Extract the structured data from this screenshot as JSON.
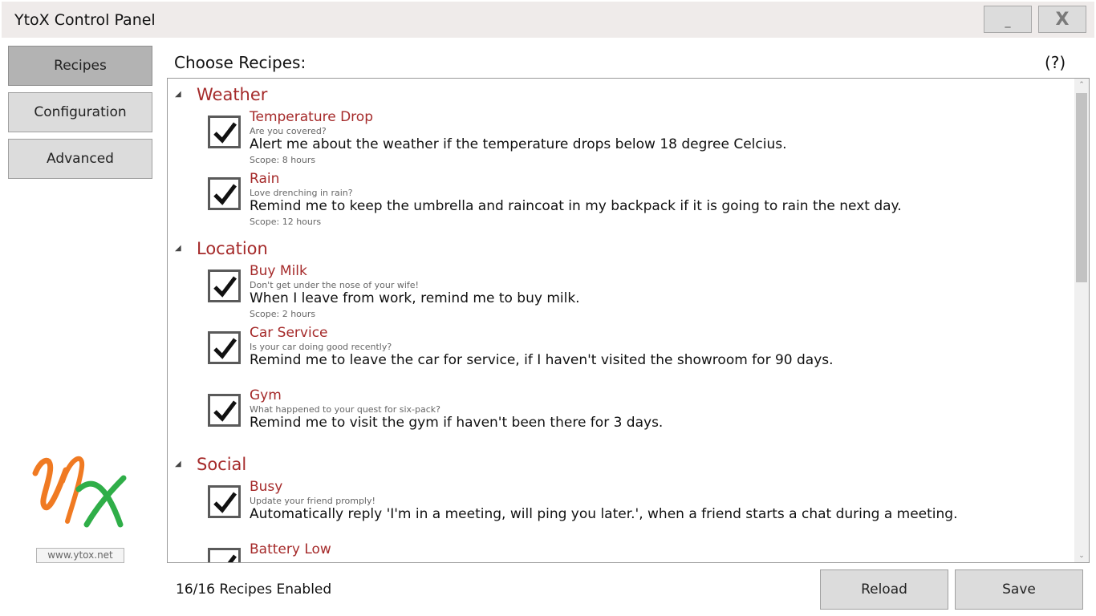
{
  "window": {
    "title": "YtoX Control Panel",
    "minimize_label": "_",
    "close_label": "X"
  },
  "sidebar": {
    "items": [
      {
        "label": "Recipes",
        "active": true
      },
      {
        "label": "Configuration",
        "active": false
      },
      {
        "label": "Advanced",
        "active": false
      }
    ],
    "logo_text": "YX",
    "website": "www.ytox.net"
  },
  "main": {
    "title": "Choose Recipes:",
    "help_label": "(?)"
  },
  "categories": [
    {
      "name": "Weather",
      "recipes": [
        {
          "name": "Temperature Drop",
          "tagline": "Are you covered?",
          "description": "Alert me about the weather if the temperature drops below 18 degree Celcius.",
          "scope": "Scope: 8 hours",
          "checked": true
        },
        {
          "name": "Rain",
          "tagline": "Love drenching in rain?",
          "description": "Remind me to keep the umbrella and raincoat in my backpack if it is going to rain the next day.",
          "scope": "Scope: 12 hours",
          "checked": true
        }
      ]
    },
    {
      "name": "Location",
      "recipes": [
        {
          "name": "Buy Milk",
          "tagline": "Don't get under the nose of your wife!",
          "description": "When I leave from work, remind me to buy milk.",
          "scope": "Scope: 2 hours",
          "checked": true
        },
        {
          "name": "Car Service",
          "tagline": "Is your car doing good recently?",
          "description": "Remind me to leave the car for service, if I haven't visited the showroom for 90 days.",
          "scope": "",
          "checked": true
        },
        {
          "name": "Gym",
          "tagline": "What happened to your quest for six-pack?",
          "description": "Remind me to visit the gym if haven't been there for 3 days.",
          "scope": "",
          "checked": true
        }
      ]
    },
    {
      "name": "Social",
      "recipes": [
        {
          "name": "Busy",
          "tagline": "Update your friend promply!",
          "description": "Automatically reply 'I'm in a meeting, will ping you later.', when a friend starts a chat during a meeting.",
          "scope": "",
          "checked": true
        },
        {
          "name": "Battery Low",
          "tagline": "",
          "description": "",
          "scope": "",
          "checked": true
        }
      ]
    }
  ],
  "footer": {
    "status": "16/16 Recipes Enabled",
    "reload_label": "Reload",
    "save_label": "Save"
  },
  "colors": {
    "accent": "#a52a2a",
    "button_bg": "#dcdcdc",
    "active_nav_bg": "#b3b3b3",
    "logo_orange": "#f07a22",
    "logo_green": "#2fae48"
  },
  "icons": {
    "category_toggle": "collapse-triangle-icon",
    "checkbox": "checkmark-icon",
    "scroll_up": "chevron-up-icon",
    "scroll_down": "chevron-down-icon"
  }
}
